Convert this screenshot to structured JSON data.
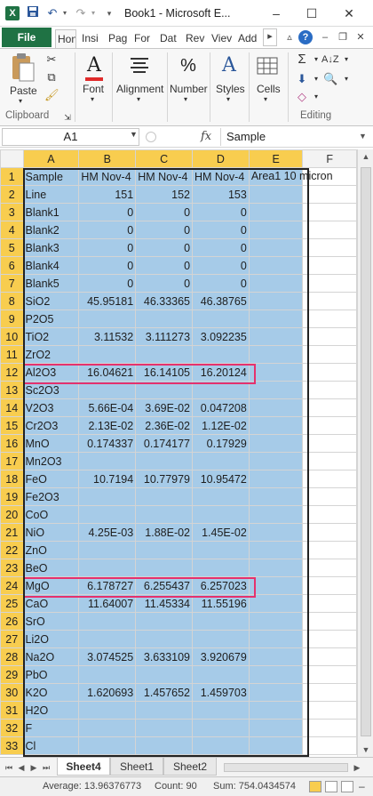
{
  "window": {
    "title": "Book1 - Microsoft E...",
    "app_icon": "excel-icon",
    "minimize": "–",
    "maximize": "☐",
    "close": "✕"
  },
  "ribbon_tabs": {
    "file": "File",
    "tabs": [
      "Hon",
      "Insi",
      "Pag",
      "For",
      "Dat",
      "Rev",
      "Viev",
      "Add"
    ],
    "active": "Hon"
  },
  "ribbon": {
    "clipboard": {
      "paste": "Paste",
      "group": "Clipboard"
    },
    "font": {
      "label": "Font"
    },
    "alignment": {
      "label": "Alignment"
    },
    "number": {
      "label": "Number"
    },
    "styles": {
      "label": "Styles"
    },
    "cells": {
      "label": "Cells"
    },
    "editing": {
      "group": "Editing"
    }
  },
  "formula_bar": {
    "name_box": "A1",
    "fx": "fx",
    "content": "Sample"
  },
  "grid": {
    "columns": [
      "A",
      "B",
      "C",
      "D",
      "E",
      "F"
    ],
    "rows": [
      {
        "n": "1",
        "a": "Sample",
        "b": "HM Nov-4",
        "c": "HM Nov-4",
        "d": "HM Nov-4",
        "e": "Area1 10 micron"
      },
      {
        "n": "2",
        "a": "Line",
        "b": "151",
        "c": "152",
        "d": "153",
        "e": ""
      },
      {
        "n": "3",
        "a": "Blank1",
        "b": "0",
        "c": "0",
        "d": "0",
        "e": ""
      },
      {
        "n": "4",
        "a": "Blank2",
        "b": "0",
        "c": "0",
        "d": "0",
        "e": ""
      },
      {
        "n": "5",
        "a": "Blank3",
        "b": "0",
        "c": "0",
        "d": "0",
        "e": ""
      },
      {
        "n": "6",
        "a": "Blank4",
        "b": "0",
        "c": "0",
        "d": "0",
        "e": ""
      },
      {
        "n": "7",
        "a": "Blank5",
        "b": "0",
        "c": "0",
        "d": "0",
        "e": ""
      },
      {
        "n": "8",
        "a": "SiO2",
        "b": "45.95181",
        "c": "46.33365",
        "d": "46.38765",
        "e": ""
      },
      {
        "n": "9",
        "a": "P2O5",
        "b": "",
        "c": "",
        "d": "",
        "e": ""
      },
      {
        "n": "10",
        "a": "TiO2",
        "b": "3.11532",
        "c": "3.111273",
        "d": "3.092235",
        "e": ""
      },
      {
        "n": "11",
        "a": "ZrO2",
        "b": "",
        "c": "",
        "d": "",
        "e": ""
      },
      {
        "n": "12",
        "a": "Al2O3",
        "b": "16.04621",
        "c": "16.14105",
        "d": "16.20124",
        "e": ""
      },
      {
        "n": "13",
        "a": "Sc2O3",
        "b": "",
        "c": "",
        "d": "",
        "e": ""
      },
      {
        "n": "14",
        "a": "V2O3",
        "b": "5.66E-04",
        "c": "3.69E-02",
        "d": "0.047208",
        "e": ""
      },
      {
        "n": "15",
        "a": "Cr2O3",
        "b": "2.13E-02",
        "c": "2.36E-02",
        "d": "1.12E-02",
        "e": ""
      },
      {
        "n": "16",
        "a": "MnO",
        "b": "0.174337",
        "c": "0.174177",
        "d": "0.17929",
        "e": ""
      },
      {
        "n": "17",
        "a": "Mn2O3",
        "b": "",
        "c": "",
        "d": "",
        "e": ""
      },
      {
        "n": "18",
        "a": "FeO",
        "b": "10.7194",
        "c": "10.77979",
        "d": "10.95472",
        "e": ""
      },
      {
        "n": "19",
        "a": "Fe2O3",
        "b": "",
        "c": "",
        "d": "",
        "e": ""
      },
      {
        "n": "20",
        "a": "CoO",
        "b": "",
        "c": "",
        "d": "",
        "e": ""
      },
      {
        "n": "21",
        "a": "NiO",
        "b": "4.25E-03",
        "c": "1.88E-02",
        "d": "1.45E-02",
        "e": ""
      },
      {
        "n": "22",
        "a": "ZnO",
        "b": "",
        "c": "",
        "d": "",
        "e": ""
      },
      {
        "n": "23",
        "a": "BeO",
        "b": "",
        "c": "",
        "d": "",
        "e": ""
      },
      {
        "n": "24",
        "a": "MgO",
        "b": "6.178727",
        "c": "6.255437",
        "d": "6.257023",
        "e": ""
      },
      {
        "n": "25",
        "a": "CaO",
        "b": "11.64007",
        "c": "11.45334",
        "d": "11.55196",
        "e": ""
      },
      {
        "n": "26",
        "a": "SrO",
        "b": "",
        "c": "",
        "d": "",
        "e": ""
      },
      {
        "n": "27",
        "a": "Li2O",
        "b": "",
        "c": "",
        "d": "",
        "e": ""
      },
      {
        "n": "28",
        "a": "Na2O",
        "b": "3.074525",
        "c": "3.633109",
        "d": "3.920679",
        "e": ""
      },
      {
        "n": "29",
        "a": "PbO",
        "b": "",
        "c": "",
        "d": "",
        "e": ""
      },
      {
        "n": "30",
        "a": "K2O",
        "b": "1.620693",
        "c": "1.457652",
        "d": "1.459703",
        "e": ""
      },
      {
        "n": "31",
        "a": "H2O",
        "b": "",
        "c": "",
        "d": "",
        "e": ""
      },
      {
        "n": "32",
        "a": "F",
        "b": "",
        "c": "",
        "d": "",
        "e": ""
      },
      {
        "n": "33",
        "a": "Cl",
        "b": "",
        "c": "",
        "d": "",
        "e": ""
      }
    ],
    "highlighted_rows": [
      "12",
      "24"
    ]
  },
  "sheets": {
    "tabs": [
      "Sheet4",
      "Sheet1",
      "Sheet2"
    ],
    "active": "Sheet4"
  },
  "status": {
    "average": "Average: 13.96376773",
    "count": "Count: 90",
    "sum": "Sum: 754.0434574"
  },
  "colors": {
    "excel_green": "#1f7244",
    "selection_fill": "#a6cbe8",
    "highlight_box": "#e5316d",
    "header_selected": "#f8cd4f"
  }
}
